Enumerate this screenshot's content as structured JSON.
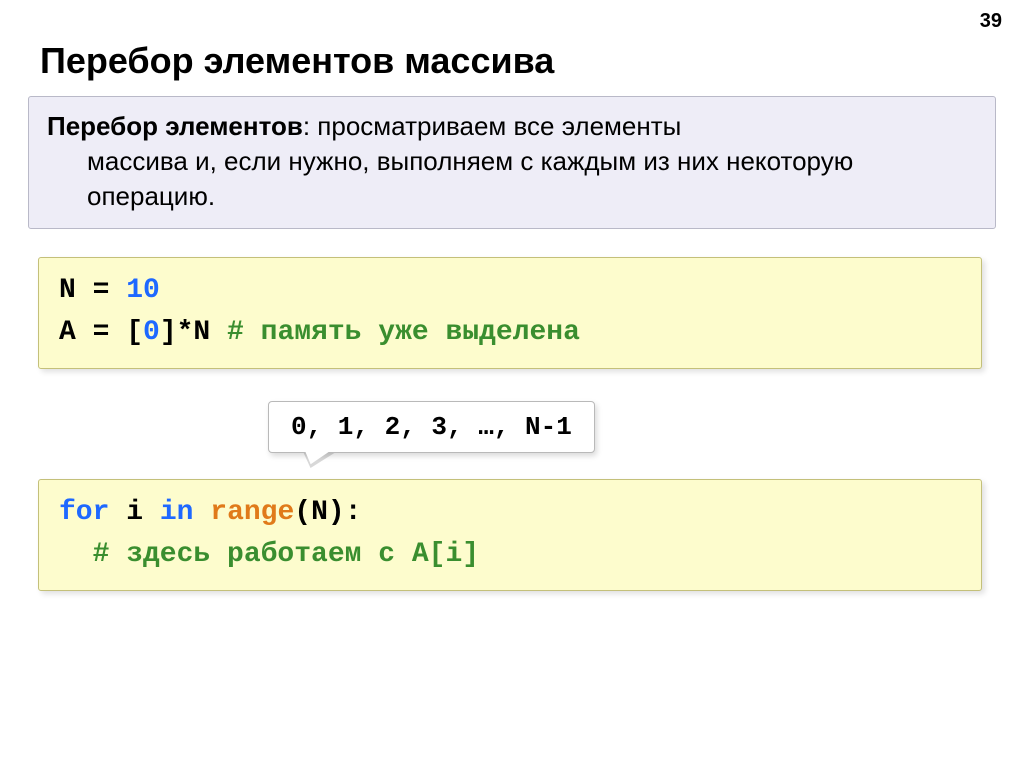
{
  "page_number": "39",
  "title": "Перебор элементов массива",
  "definition": {
    "term": "Перебор элементов",
    "line1_rest": ": просматриваем все элементы",
    "line2": "массива и, если нужно, выполняем с каждым из них некоторую операцию."
  },
  "code1": {
    "l1_a": "N = ",
    "l1_b": "10",
    "l2_a": "A = [",
    "l2_b": "0",
    "l2_c": "]*N   ",
    "l2_d": "# память уже выделена"
  },
  "callout_text": "0, 1, 2, 3, …, N-1",
  "code2": {
    "l1_a": "for",
    "l1_b": " i ",
    "l1_c": "in",
    "l1_d": " ",
    "l1_e": "range",
    "l1_f": "(N):",
    "l2": "# здесь работаем с A[i]"
  }
}
